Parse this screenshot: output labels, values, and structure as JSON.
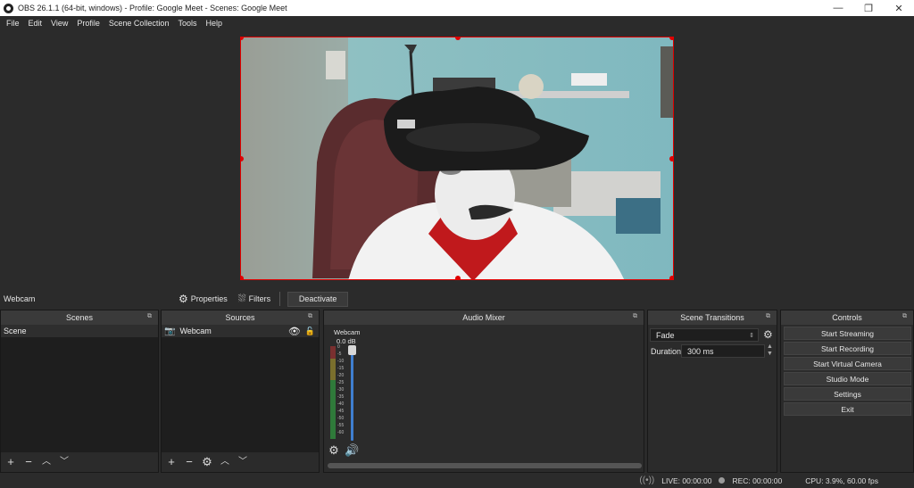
{
  "window": {
    "title": "OBS 26.1.1 (64-bit, windows) - Profile: Google Meet - Scenes: Google Meet",
    "minimize": "—",
    "restore": "❐",
    "close": "✕"
  },
  "menu": [
    "File",
    "Edit",
    "View",
    "Profile",
    "Scene Collection",
    "Tools",
    "Help"
  ],
  "source_toolbar": {
    "selected_source": "Webcam",
    "properties_label": "Properties",
    "filters_label": "Filters",
    "deactivate_label": "Deactivate"
  },
  "scenes": {
    "title": "Scenes",
    "items": [
      "Scene"
    ]
  },
  "sources": {
    "title": "Sources",
    "items": [
      {
        "name": "Webcam",
        "visible": true,
        "locked": false
      }
    ]
  },
  "mixer": {
    "title": "Audio Mixer",
    "channel_name": "Webcam",
    "db_readout": "0.0 dB",
    "scale": [
      "0",
      "-5",
      "-10",
      "-15",
      "-20",
      "-25",
      "-30",
      "-35",
      "-40",
      "-45",
      "-50",
      "-55",
      "-60"
    ],
    "volume_fraction": 1.0
  },
  "transitions": {
    "title": "Scene Transitions",
    "selected": "Fade",
    "duration_label": "Duration",
    "duration_value": "300 ms"
  },
  "controls": {
    "title": "Controls",
    "buttons": [
      "Start Streaming",
      "Start Recording",
      "Start Virtual Camera",
      "Studio Mode",
      "Settings",
      "Exit"
    ]
  },
  "status": {
    "live": "LIVE: 00:00:00",
    "rec": "REC: 00:00:00",
    "cpu": "CPU: 3.9%, 60.00 fps"
  },
  "colors": {
    "selection_border": "#e00000",
    "meter_green": "#33c24a",
    "meter_yellow": "#c9b33a",
    "meter_red": "#c23333",
    "slider_blue": "#3f7fd0"
  }
}
